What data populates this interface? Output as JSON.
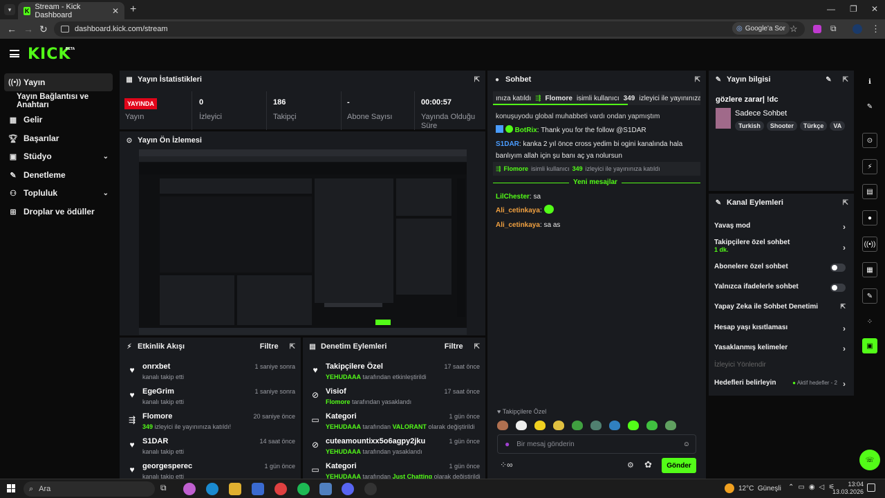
{
  "browser": {
    "tab_title": "Stream - Kick Dashboard",
    "url": "dashboard.kick.com/stream",
    "google_lens_label": "Google'a Sor"
  },
  "app": {
    "logo": "KICK",
    "logo_badge": "BETA"
  },
  "sidebar": {
    "items": [
      {
        "label": "Yayın",
        "icon": "broadcast-icon"
      },
      {
        "label": "Yayın Bağlantısı ve Anahtarı",
        "icon": ""
      },
      {
        "label": "Gelir",
        "icon": "chart-icon"
      },
      {
        "label": "Başarılar",
        "icon": "trophy-icon"
      },
      {
        "label": "Stüdyo",
        "icon": "studio-icon"
      },
      {
        "label": "Denetleme",
        "icon": "wrench-icon"
      },
      {
        "label": "Topluluk",
        "icon": "people-icon"
      },
      {
        "label": "Droplar ve ödüller",
        "icon": "drops-icon"
      }
    ]
  },
  "stats": {
    "title": "Yayın İstatistikleri",
    "live_badge": "YAYINDA",
    "live_label": "Yayın",
    "viewers_value": "0",
    "viewers_label": "İzleyici",
    "followers_value": "186",
    "followers_label": "Takipçi",
    "subs_value": "-",
    "subs_label": "Abone Sayısı",
    "uptime_value": "00:00:57",
    "uptime_label": "Yayında Olduğu Süre"
  },
  "preview": {
    "title": "Yayın Ön İzlemesi"
  },
  "activity": {
    "title": "Etkinlik Akışı",
    "filter": "Filtre",
    "rows": [
      {
        "name": "onrxbet",
        "sub": "kanalı takip etti",
        "time": "1 saniye sonra",
        "icon": "heart-icon"
      },
      {
        "name": "EgeGrim",
        "sub": "kanalı takip etti",
        "time": "1 saniye sonra",
        "icon": "heart-icon"
      },
      {
        "name": "Flomore",
        "sub_highlight": "349",
        "sub": "izleyici ile yayınınıza katıldı!",
        "time": "20 saniye önce",
        "icon": "raid-icon"
      },
      {
        "name": "S1DAR",
        "sub": "kanalı takip etti",
        "time": "14 saat önce",
        "icon": "heart-icon"
      },
      {
        "name": "georgesperec",
        "sub": "kanalı takip etti",
        "time": "1 gün önce",
        "icon": "heart-icon"
      }
    ]
  },
  "moderation": {
    "title": "Denetim Eylemleri",
    "filter": "Filtre",
    "rows": [
      {
        "name": "Takipçilere Özel",
        "hl": "YEHUDAAA",
        "sub": "tarafından etkinleştirildi",
        "time": "17 saat önce",
        "icon": "heart-icon"
      },
      {
        "name": "Visiof",
        "hl": "Flomore",
        "sub": "tarafından yasaklandı",
        "time": "17 saat önce",
        "icon": "ban-icon"
      },
      {
        "name": "Kategori",
        "hl": "YEHUDAAA",
        "sub": "tarafından",
        "hl2": "VALORANT",
        "sub2": "olarak değiştirildi",
        "time": "1 gün önce",
        "icon": "category-icon"
      },
      {
        "name": "cuteamountixx5o6agpy2jku",
        "hl": "YEHUDAAA",
        "sub": "tarafından yasaklandı",
        "time": "1 gün önce",
        "icon": "ban-icon"
      },
      {
        "name": "Kategori",
        "hl": "YEHUDAAA",
        "sub": "tarafından",
        "hl2": "Just Chatting",
        "sub2": "olarak değiştirildi",
        "time": "1 gün önce",
        "icon": "category-icon"
      }
    ]
  },
  "chat": {
    "title": "Sohbet",
    "ticker_prefix": "ınıza katıldı",
    "ticker_user": "Flomore",
    "ticker_mid": "isimli kullanıcı",
    "ticker_count": "349",
    "ticker_suffix": "izleyici ile yayınınıza k",
    "msg_partial": "konuşuyodu global muhabbeti vardı ondan yapmıştım",
    "botrix_user": "BotRix",
    "botrix_text": "Thank you for the follow @S1DAR",
    "s1dar_user": "S1DAR",
    "s1dar_text": "kanka 2 yıl önce cross yedim bi ogini kanalında hala banlıyım allah için şu banı aç ya nolursun",
    "sys_user": "Flomore",
    "sys_mid": "isimli kullanıcı",
    "sys_count": "349",
    "sys_suffix": "izleyici ile yayınınıza katıldı",
    "new_messages": "Yeni mesajlar",
    "m1_user": "LilChester",
    "m1_text": "sa",
    "m2_user": "Ali_cetinkaya",
    "m3_user": "Ali_cetinkaya",
    "m3_text": "sa as",
    "followers_only": "Takipçilere Özel",
    "placeholder": "Bir mesaj gönderin",
    "send": "Gönder",
    "colors": {
      "lilchester": "#53fc18",
      "ali": "#f0a040",
      "s1dar": "#4a9cff",
      "botrix": "#53fc18"
    }
  },
  "stream_info": {
    "title_label": "Yayın bilgisi",
    "stream_title": "gözlere zarar| !dc",
    "category": "Sadece Sohbet",
    "tags": [
      "Turkish",
      "Shooter",
      "Türkçe",
      "VA"
    ]
  },
  "channel_actions": {
    "title": "Kanal Eylemleri",
    "items": [
      {
        "label": "Yavaş mod",
        "type": "chevron"
      },
      {
        "label": "Takipçilere özel sohbet",
        "sub": "1 dk.",
        "type": "chevron"
      },
      {
        "label": "Abonelere özel sohbet",
        "type": "toggle"
      },
      {
        "label": "Yalnızca ifadelerle sohbet",
        "type": "toggle"
      },
      {
        "label": "Yapay Zeka ile Sohbet Denetimi",
        "type": "external"
      },
      {
        "label": "Hesap yaşı kısıtlaması",
        "type": "chevron"
      },
      {
        "label": "Yasaklanmış kelimeler",
        "type": "chevron"
      },
      {
        "label": "İzleyici Yönlendir",
        "type": "disabled"
      },
      {
        "label": "Hedefleri belirleyin",
        "status": "Aktif hedefler - 2",
        "type": "chevron"
      }
    ]
  },
  "taskbar": {
    "search": "Ara",
    "weather": "12°C",
    "weather_desc": "Güneşli",
    "time": "13:04",
    "date": "13.03.2026"
  }
}
